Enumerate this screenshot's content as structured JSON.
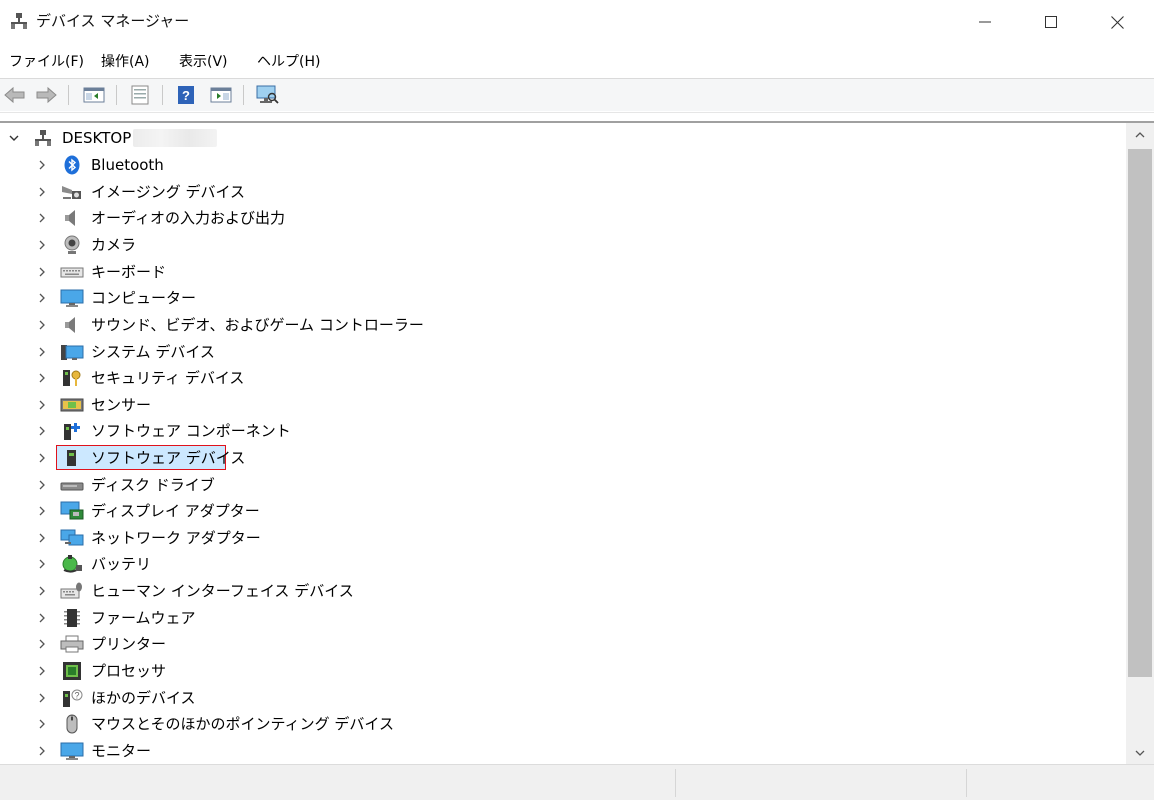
{
  "window": {
    "title": "デバイス マネージャー",
    "icon": "device-manager-icon",
    "controls": [
      "minimize-icon",
      "maximize-icon",
      "close-icon"
    ]
  },
  "menu": {
    "items": [
      {
        "label": "ファイル(F)"
      },
      {
        "label": "操作(A)"
      },
      {
        "label": "表示(V)"
      },
      {
        "label": "ヘルプ(H)"
      }
    ]
  },
  "toolbar": {
    "buttons": [
      "back-arrow-icon",
      "forward-arrow-icon",
      "show-hide-console-tree-icon",
      "properties-icon",
      "help-icon",
      "action-pane-icon",
      "scan-hardware-icon"
    ]
  },
  "tree": {
    "root": {
      "label": "DESKTOP",
      "icon": "computer-network-icon",
      "expanded": true
    },
    "items": [
      {
        "label": "Bluetooth",
        "icon": "bluetooth-icon"
      },
      {
        "label": "イメージング デバイス",
        "icon": "imaging-device-icon"
      },
      {
        "label": "オーディオの入力および出力",
        "icon": "speaker-icon"
      },
      {
        "label": "カメラ",
        "icon": "webcam-icon"
      },
      {
        "label": "キーボード",
        "icon": "keyboard-icon"
      },
      {
        "label": "コンピューター",
        "icon": "monitor-icon"
      },
      {
        "label": "サウンド、ビデオ、およびゲーム コントローラー",
        "icon": "speaker-icon"
      },
      {
        "label": "システム デバイス",
        "icon": "system-device-icon"
      },
      {
        "label": "セキュリティ デバイス",
        "icon": "security-key-icon"
      },
      {
        "label": "センサー",
        "icon": "sensor-icon"
      },
      {
        "label": "ソフトウェア コンポーネント",
        "icon": "software-component-icon"
      },
      {
        "label": "ソフトウェア デバイス",
        "icon": "software-device-icon",
        "selected": true
      },
      {
        "label": "ディスク ドライブ",
        "icon": "disk-drive-icon"
      },
      {
        "label": "ディスプレイ アダプター",
        "icon": "display-adapter-icon"
      },
      {
        "label": "ネットワーク アダプター",
        "icon": "network-adapter-icon"
      },
      {
        "label": "バッテリ",
        "icon": "battery-icon"
      },
      {
        "label": "ヒューマン インターフェイス デバイス",
        "icon": "hid-icon"
      },
      {
        "label": "ファームウェア",
        "icon": "firmware-chip-icon"
      },
      {
        "label": "プリンター",
        "icon": "printer-icon"
      },
      {
        "label": "プロセッサ",
        "icon": "processor-icon"
      },
      {
        "label": "ほかのデバイス",
        "icon": "other-device-icon"
      },
      {
        "label": "マウスとそのほかのポインティング デバイス",
        "icon": "mouse-icon"
      },
      {
        "label": "モニター",
        "icon": "monitor-icon"
      }
    ]
  },
  "colors": {
    "selection_border": "#e0121b",
    "selection_fill": "#cce8ff",
    "toolbar_bg": "#f5f6f7",
    "status_bg": "#f0f0f0"
  }
}
